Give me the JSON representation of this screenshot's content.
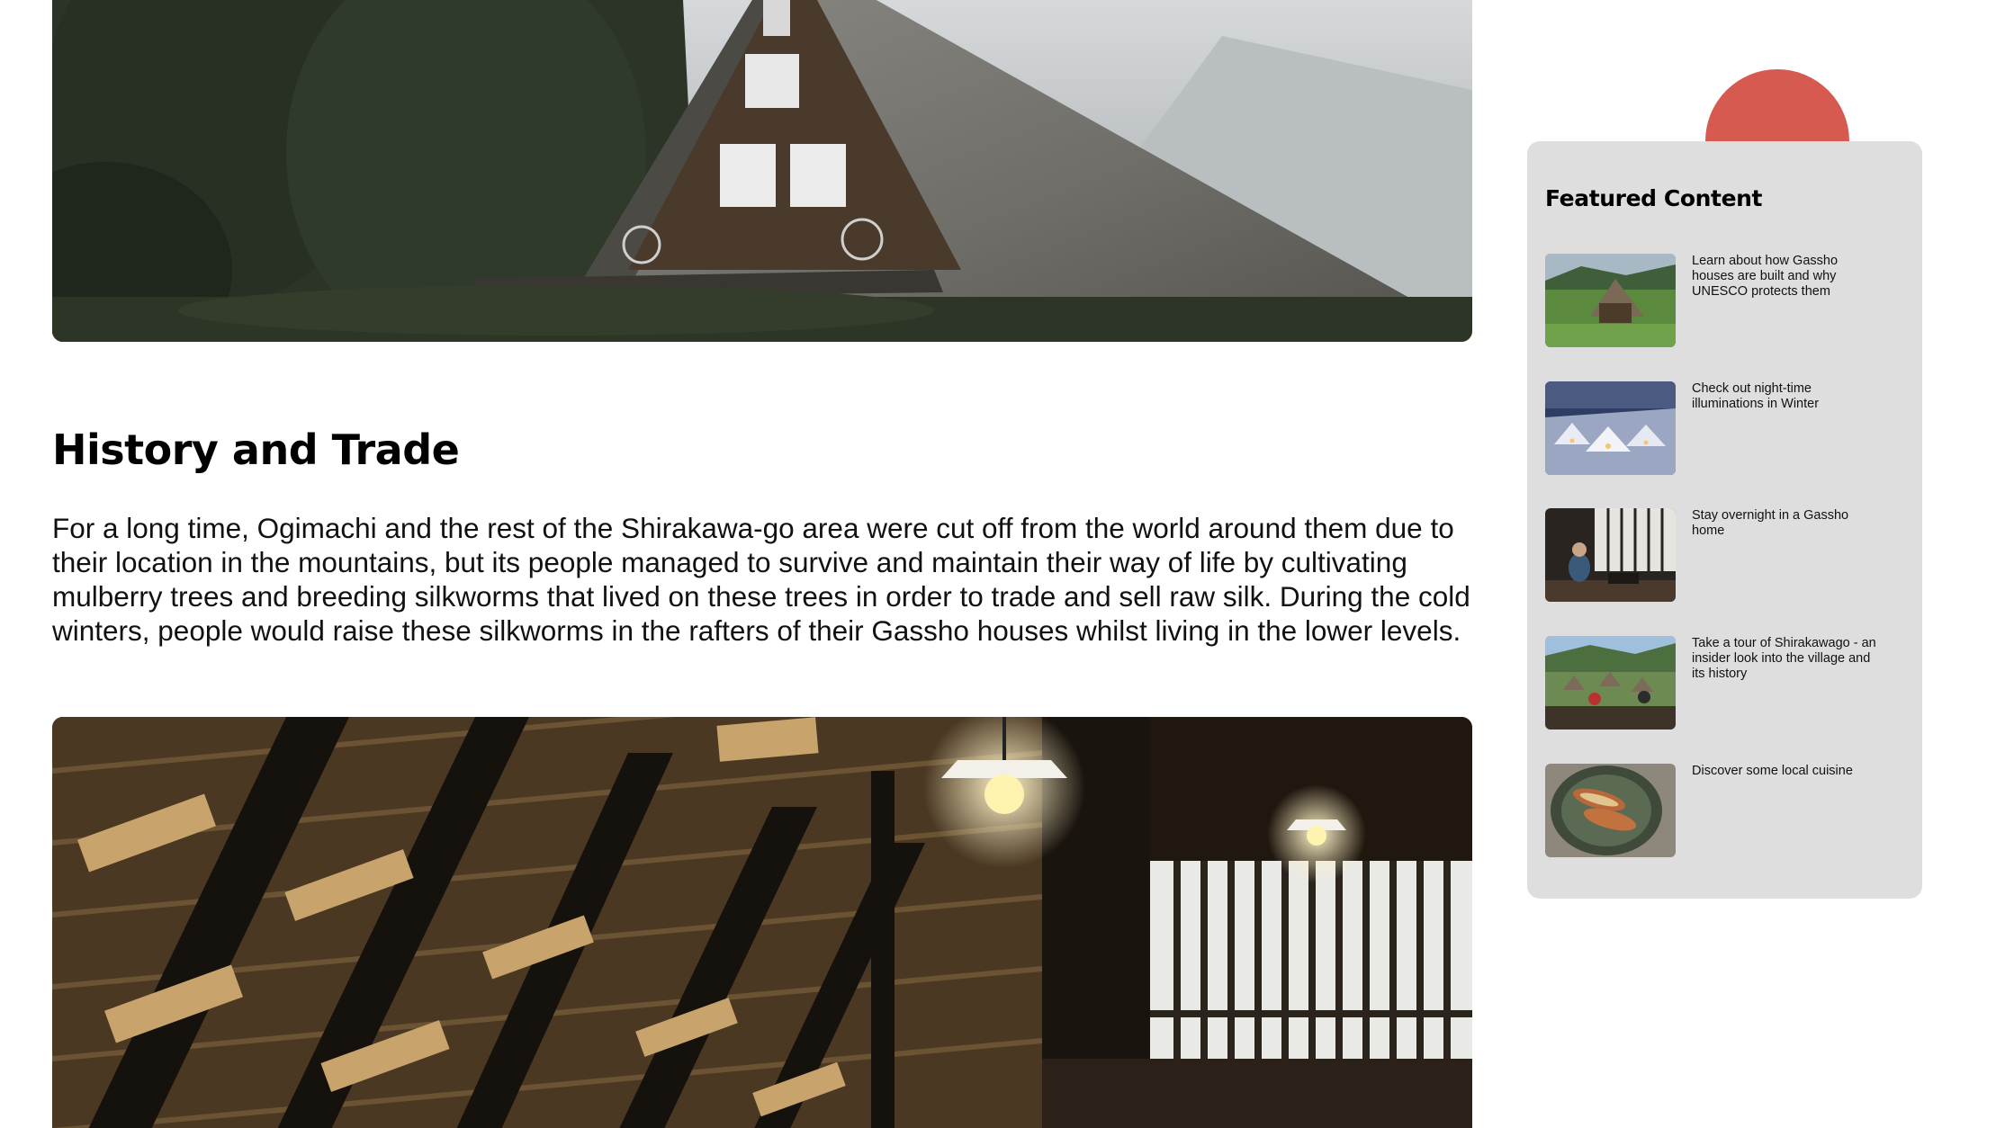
{
  "article": {
    "section_heading": "History and Trade",
    "section_body": "For a long time, Ogimachi and the rest of the Shirakawa-go area were cut off from the world around them due to their location in the mountains, but its people managed to survive and maintain their way of life by cultivating mulberry trees and breeding silkworms that lived on these trees in order to trade and sell raw silk. During the cold winters, people would raise these silkworms in the rafters of their Gassho houses whilst living in the lower levels."
  },
  "sidebar": {
    "title": "Featured Content",
    "items": [
      {
        "label": "Learn about how Gassho houses are built and why UNESCO protects them"
      },
      {
        "label": "Check out night-time illuminations in Winter"
      },
      {
        "label": "Stay overnight in a Gassho home"
      },
      {
        "label": "Take a tour of Shirakawago - an insider look into the village and its history"
      },
      {
        "label": "Discover some local cuisine"
      }
    ]
  },
  "colors": {
    "accent_circle": "#d65a50",
    "panel_background": "#dedede"
  }
}
